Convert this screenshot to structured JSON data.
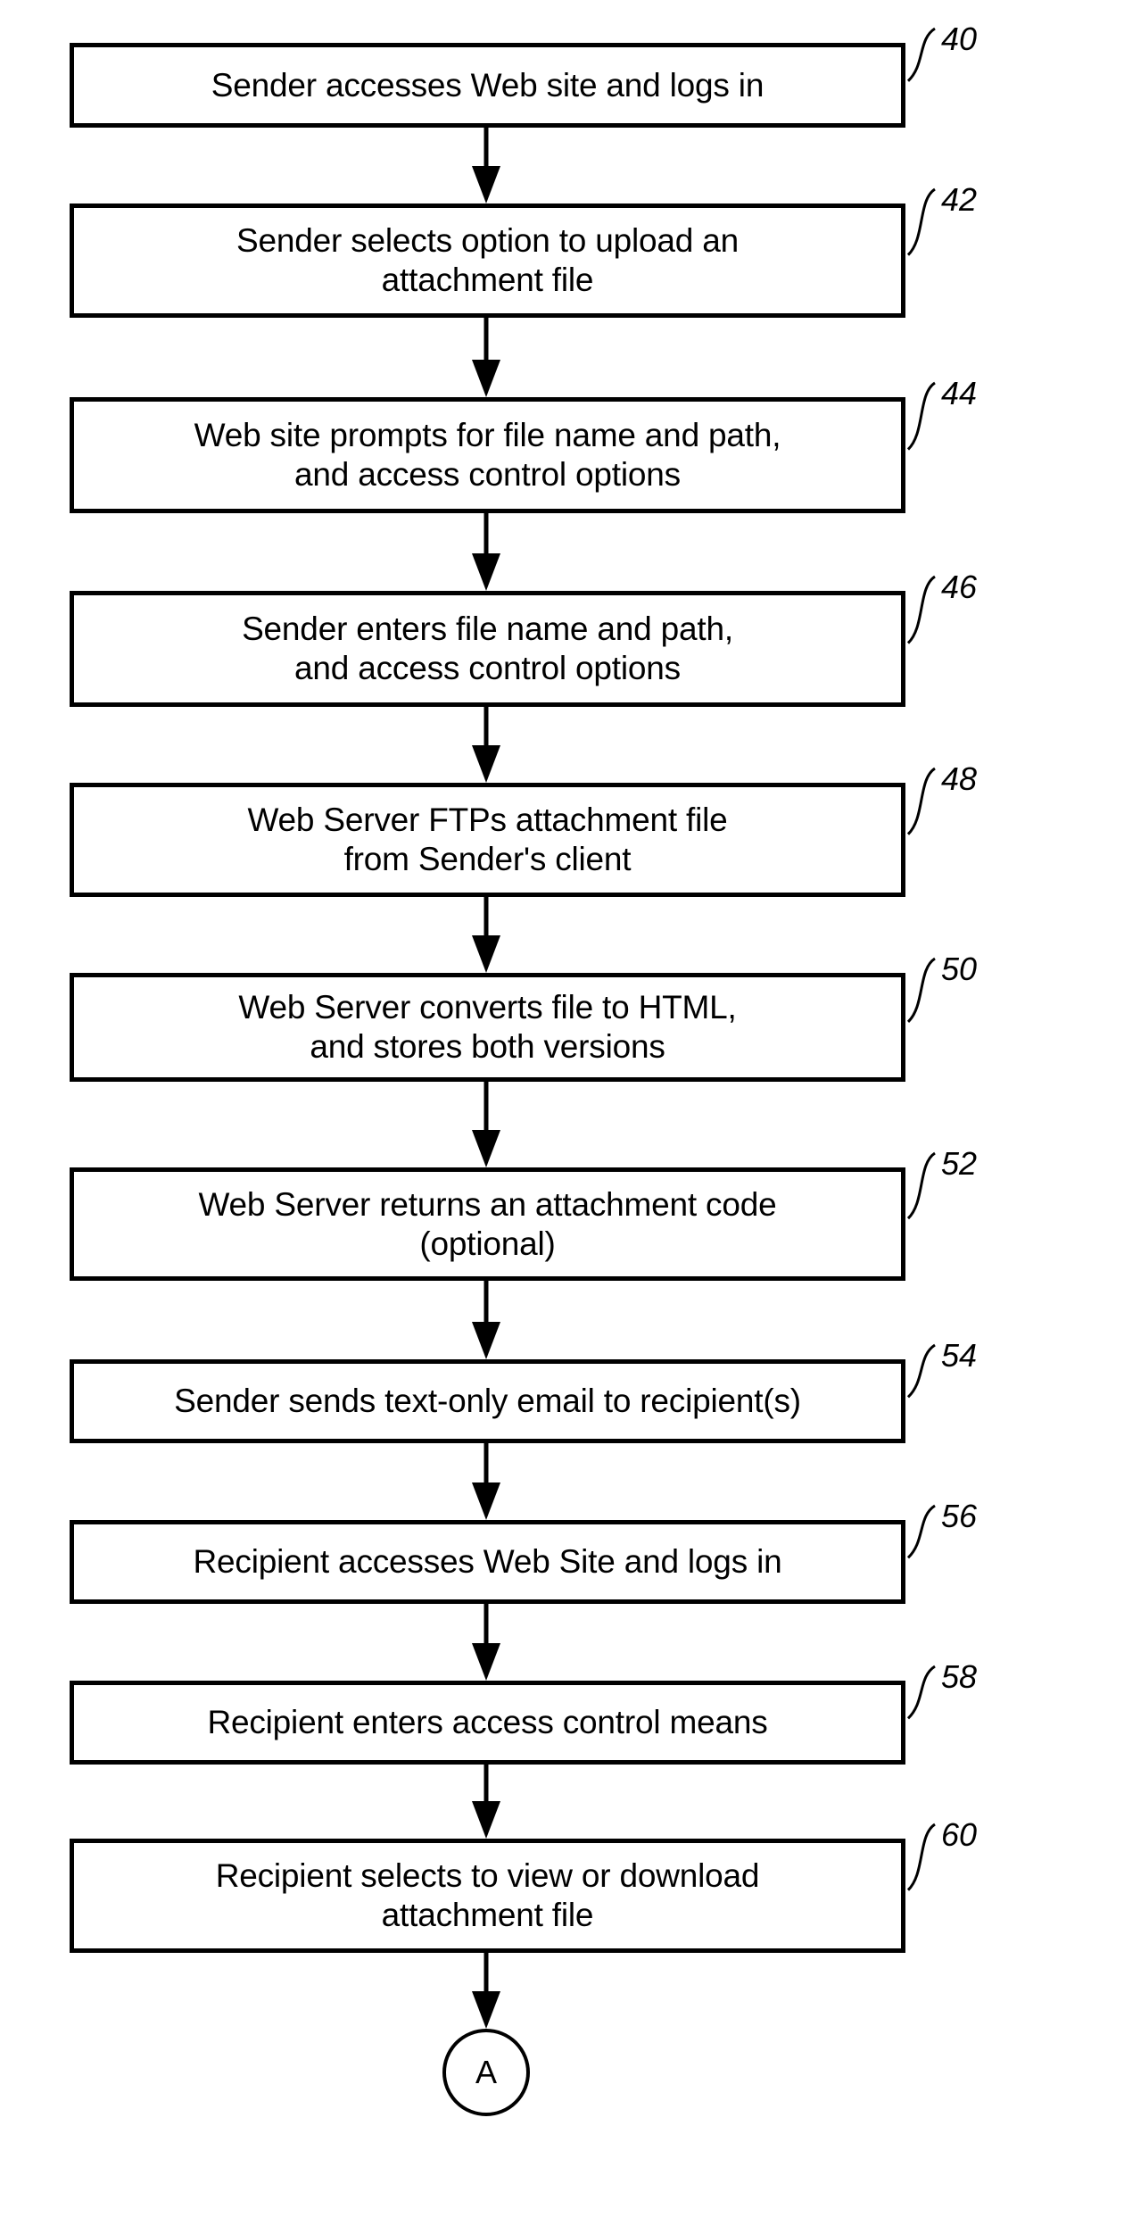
{
  "figure": {
    "type": "flowchart",
    "steps": [
      {
        "ref": "40",
        "text": "Sender accesses Web site and logs in"
      },
      {
        "ref": "42",
        "text": "Sender selects option to upload an\nattachment file"
      },
      {
        "ref": "44",
        "text": "Web site prompts for file name and path,\nand access control options"
      },
      {
        "ref": "46",
        "text": "Sender enters file name and path,\nand access control options"
      },
      {
        "ref": "48",
        "text": "Web Server FTPs attachment file\nfrom Sender's client"
      },
      {
        "ref": "50",
        "text": "Web Server converts file to HTML,\nand stores both versions"
      },
      {
        "ref": "52",
        "text": "Web Server returns an attachment code\n(optional)"
      },
      {
        "ref": "54",
        "text": "Sender sends text-only email to recipient(s)"
      },
      {
        "ref": "56",
        "text": "Recipient accesses Web Site and logs in"
      },
      {
        "ref": "58",
        "text": "Recipient enters access control means"
      },
      {
        "ref": "60",
        "text": "Recipient selects to view or download\nattachment file"
      }
    ],
    "connector": {
      "label": "A"
    },
    "colors": {
      "ink": "#000000",
      "paper": "#ffffff"
    }
  }
}
